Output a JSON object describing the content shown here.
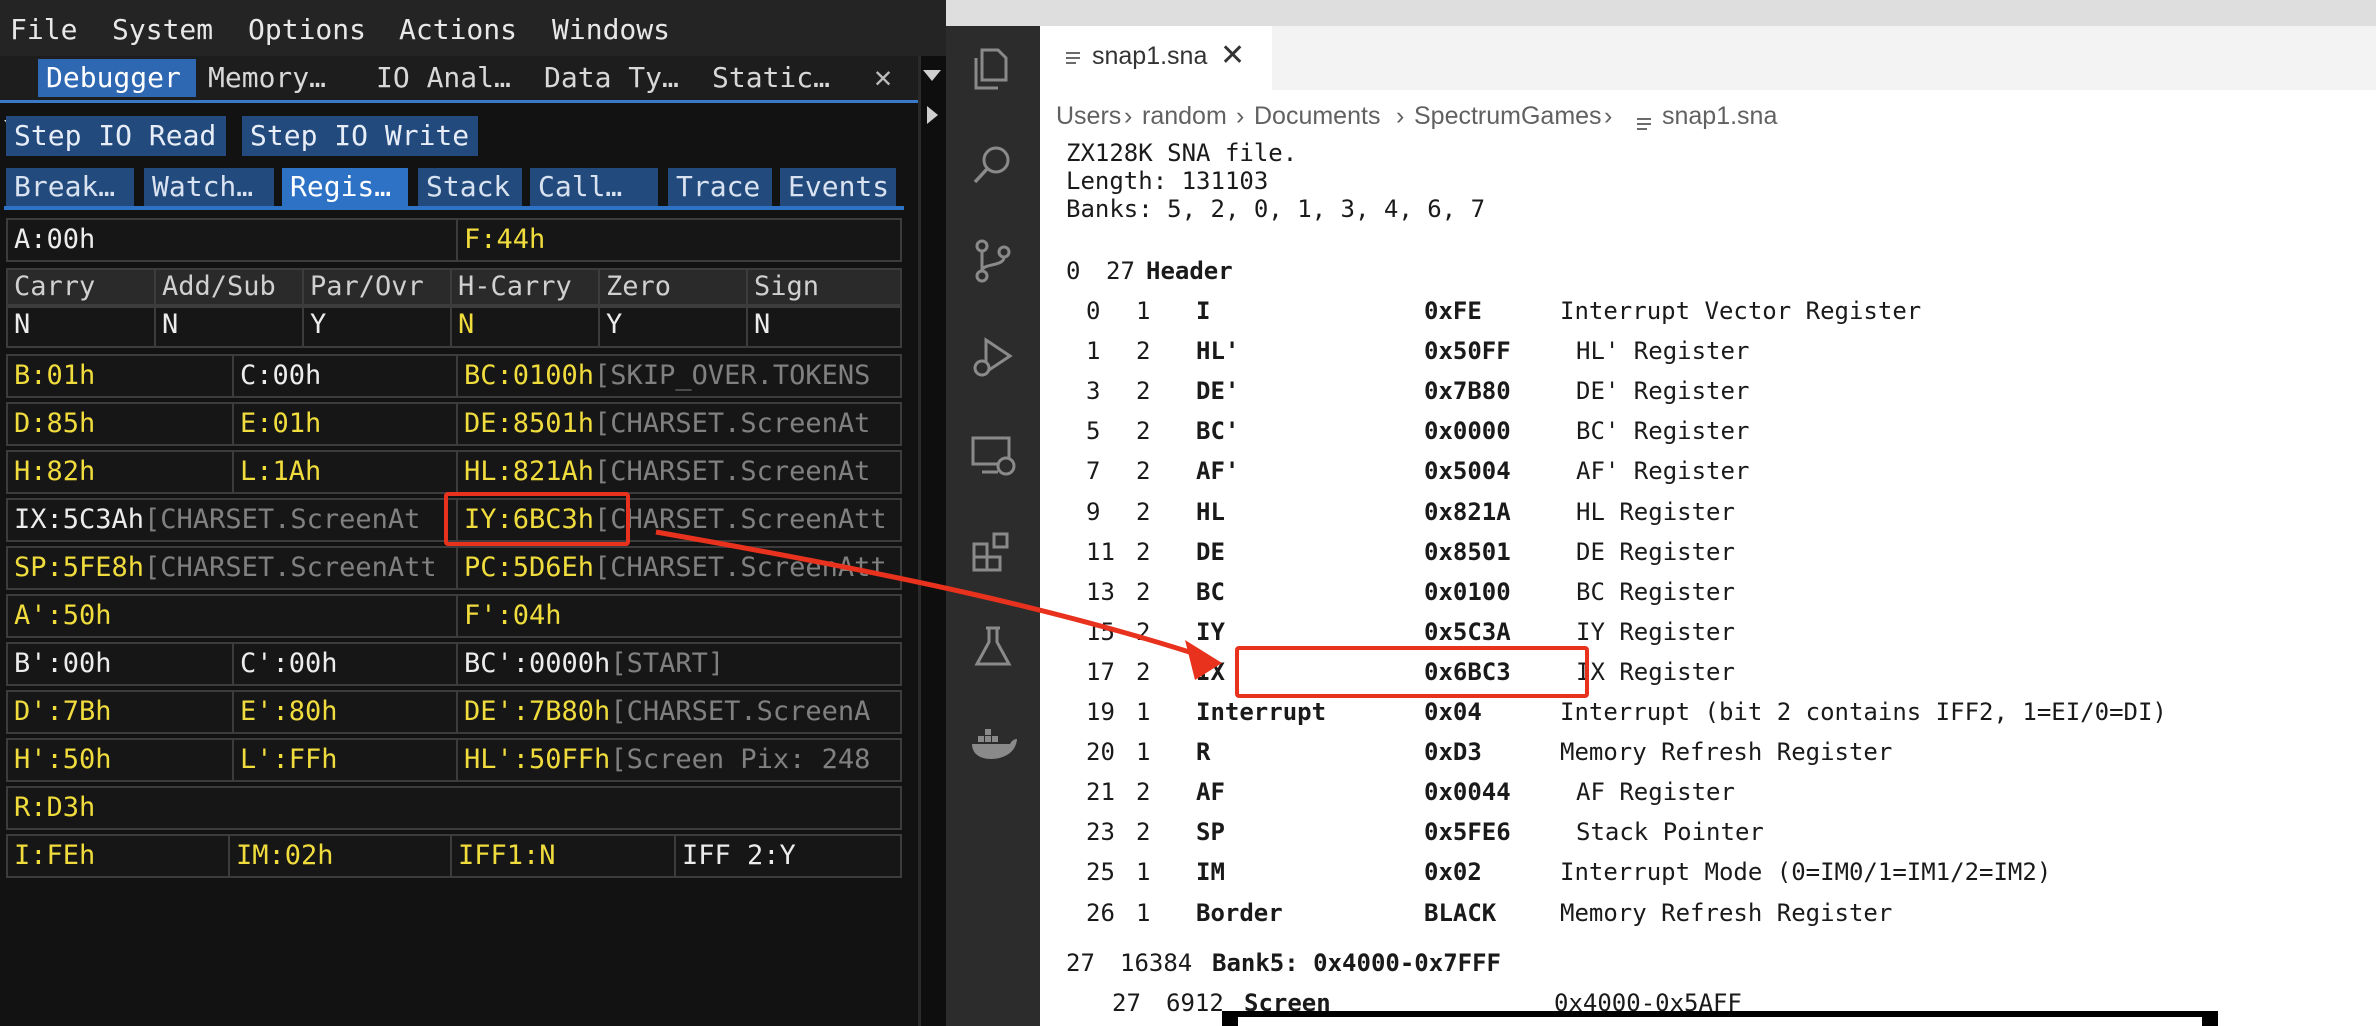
{
  "menu": [
    "File",
    "System",
    "Options",
    "Actions",
    "Windows"
  ],
  "window_tabs": [
    "Debugger",
    "Memory…",
    "IO Anal…",
    "Data Ty…",
    "Static…"
  ],
  "toolbar": {
    "step_io_read": "Step IO Read",
    "step_io_write": "Step IO Write"
  },
  "sub_tabs": [
    "Break…",
    "Watch…",
    "Regis…",
    "Stack",
    "Call…",
    "Trace",
    "Events"
  ],
  "registers": {
    "a": "A:00h",
    "f": "F:44h",
    "flag_headers": [
      "Carry",
      "Add/Sub",
      "Par/Ovr",
      "H-Carry",
      "Zero",
      "Sign"
    ],
    "flag_values": [
      "N",
      "N",
      "Y",
      "N",
      "Y",
      "N"
    ],
    "b": "B:01h",
    "c": "C:00h",
    "bc": "BC:0100h",
    "bc_note": "[SKIP_OVER.TOKENS",
    "d": "D:85h",
    "e": "E:01h",
    "de": "DE:8501h",
    "de_note": "[CHARSET.ScreenAt",
    "h": "H:82h",
    "l": "L:1Ah",
    "hl": "HL:821Ah",
    "hl_note": "[CHARSET.ScreenAt",
    "ix": "IX:5C3Ah",
    "ix_note": "[CHARSET.ScreenAt",
    "iy": "IY:6BC3h",
    "iy_note": "[CHARSET.ScreenAtt",
    "sp": "SP:5FE8h",
    "sp_note": "[CHARSET.ScreenAtt",
    "pc": "PC:5D6Eh",
    "pc_note": "[CHARSET.ScreenAtt",
    "a2": "A':50h",
    "f2": "F':04h",
    "b2": "B':00h",
    "c2": "C':00h",
    "bc2": "BC':0000h",
    "bc2_note": "[START]",
    "d2": "D':7Bh",
    "e2": "E':80h",
    "de2": "DE':7B80h",
    "de2_note": "[CHARSET.ScreenA",
    "h2": "H':50h",
    "l2": "L':FFh",
    "hl2": "HL':50FFh",
    "hl2_note": "[Screen Pix: 248",
    "r": "R:D3h",
    "i": "I:FEh",
    "im": "IM:02h",
    "iff1": "IFF1:N",
    "iff2": "IFF 2:Y"
  },
  "editor": {
    "tab_name": "snap1.sna",
    "breadcrumb": [
      "Users",
      "random",
      "Documents",
      "SpectrumGames",
      "snap1.sna"
    ],
    "summary": [
      "ZX128K SNA file.",
      "Length: 131103",
      "Banks: 5, 2, 0, 1, 3, 4, 6, 7"
    ],
    "header_section": {
      "offset": "0",
      "size": "27",
      "name": "Header"
    },
    "fields": [
      {
        "off": "0",
        "len": "1",
        "name": "I",
        "val": "0xFE",
        "desc": "Interrupt Vector Register"
      },
      {
        "off": "1",
        "len": "2",
        "name": "HL'",
        "val": "0x50FF",
        "desc": "HL' Register"
      },
      {
        "off": "3",
        "len": "2",
        "name": "DE'",
        "val": "0x7B80",
        "desc": "DE' Register"
      },
      {
        "off": "5",
        "len": "2",
        "name": "BC'",
        "val": "0x0000",
        "desc": "BC' Register"
      },
      {
        "off": "7",
        "len": "2",
        "name": "AF'",
        "val": "0x5004",
        "desc": "AF' Register"
      },
      {
        "off": "9",
        "len": "2",
        "name": "HL",
        "val": "0x821A",
        "desc": "HL Register"
      },
      {
        "off": "11",
        "len": "2",
        "name": "DE",
        "val": "0x8501",
        "desc": "DE Register"
      },
      {
        "off": "13",
        "len": "2",
        "name": "BC",
        "val": "0x0100",
        "desc": "BC Register"
      },
      {
        "off": "15",
        "len": "2",
        "name": "IY",
        "val": "0x5C3A",
        "desc": "IY Register"
      },
      {
        "off": "17",
        "len": "2",
        "name": "IX",
        "val": "0x6BC3",
        "desc": "IX Register"
      },
      {
        "off": "19",
        "len": "1",
        "name": "Interrupt",
        "val": "0x04",
        "desc": "Interrupt (bit 2 contains IFF2, 1=EI/0=DI)"
      },
      {
        "off": "20",
        "len": "1",
        "name": "R",
        "val": "0xD3",
        "desc": "Memory Refresh Register"
      },
      {
        "off": "21",
        "len": "2",
        "name": "AF",
        "val": "0x0044",
        "desc": "AF Register"
      },
      {
        "off": "23",
        "len": "2",
        "name": "SP",
        "val": "0x5FE6",
        "desc": "Stack Pointer"
      },
      {
        "off": "25",
        "len": "1",
        "name": "IM",
        "val": "0x02",
        "desc": "Interrupt Mode (0=IM0/1=IM1/2=IM2)"
      },
      {
        "off": "26",
        "len": "1",
        "name": "Border",
        "val": "BLACK",
        "desc": "Memory Refresh Register"
      }
    ],
    "bank_line": {
      "off": "27",
      "len": "16384",
      "name": "Bank5: 0x4000-0x7FFF"
    },
    "screen_line": {
      "off": "27",
      "len": "6912",
      "name": "Screen",
      "range": "0x4000-0x5AFF"
    }
  },
  "colors": {
    "highlight_box": "#e8321e",
    "accent_blue": "#2e67b2",
    "reg_yellow": "#f0dc3c"
  },
  "activity_icons": [
    "files-icon",
    "search-icon",
    "source-control-icon",
    "run-debug-icon",
    "remote-explorer-icon",
    "extensions-icon",
    "testing-icon",
    "docker-icon"
  ]
}
